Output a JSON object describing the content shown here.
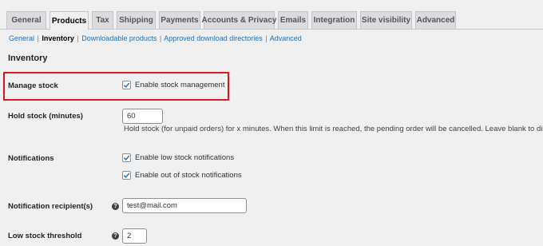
{
  "tabs": [
    {
      "label": "General"
    },
    {
      "label": "Products"
    },
    {
      "label": "Tax"
    },
    {
      "label": "Shipping"
    },
    {
      "label": "Payments"
    },
    {
      "label": "Accounts & Privacy"
    },
    {
      "label": "Emails"
    },
    {
      "label": "Integration"
    },
    {
      "label": "Site visibility"
    },
    {
      "label": "Advanced"
    }
  ],
  "active_tab": "Products",
  "subnav": {
    "general": "General",
    "inventory": "Inventory",
    "downloadable": "Downloadable products",
    "approved": "Approved download directories",
    "advanced": "Advanced",
    "separator": "|"
  },
  "section_title": "Inventory",
  "manage_stock": {
    "label": "Manage stock",
    "checkbox_label": "Enable stock management",
    "checked": true
  },
  "hold_stock": {
    "label": "Hold stock (minutes)",
    "value": "60",
    "description": "Hold stock (for unpaid orders) for x minutes. When this limit is reached, the pending order will be cancelled. Leave blank to disable."
  },
  "notifications": {
    "label": "Notifications",
    "low_stock_label": "Enable low stock notifications",
    "out_of_stock_label": "Enable out of stock notifications"
  },
  "recipient": {
    "label": "Notification recipient(s)",
    "value": "test@mail.com",
    "help": "?"
  },
  "low_stock_threshold": {
    "label": "Low stock threshold",
    "value": "2",
    "help": "?"
  },
  "colors": {
    "link": "#2271b1",
    "highlight": "#e0141e",
    "background": "#f0f0f1",
    "tab_inactive": "#dcdcde",
    "checkmark": "#2271b1"
  }
}
